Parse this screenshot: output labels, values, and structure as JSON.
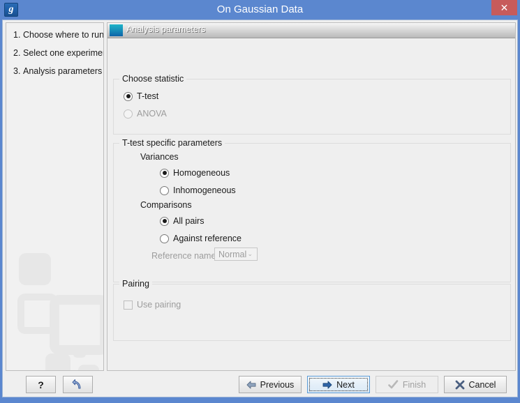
{
  "window": {
    "title": "On Gaussian Data",
    "app_icon": "g",
    "close_label": "✕",
    "accent_color": "#5b87cf",
    "close_color": "#c75b5b"
  },
  "sidebar": {
    "steps": [
      {
        "num": "1.",
        "label": "Choose where to run"
      },
      {
        "num": "2.",
        "label": "Select one experiment"
      },
      {
        "num": "3.",
        "label": "Analysis parameters"
      }
    ]
  },
  "panel": {
    "header_title": "Analysis parameters",
    "header_icon": "teal-square-icon"
  },
  "groups": {
    "choose_statistic": {
      "title": "Choose statistic",
      "options": [
        {
          "label": "T-test",
          "selected": true,
          "disabled": false
        },
        {
          "label": "ANOVA",
          "selected": false,
          "disabled": true
        }
      ]
    },
    "ttest_params": {
      "title": "T-test specific parameters",
      "variances_label": "Variances",
      "variances": [
        {
          "label": "Homogeneous",
          "selected": true,
          "disabled": false
        },
        {
          "label": "Inhomogeneous",
          "selected": false,
          "disabled": false
        }
      ],
      "comparisons_label": "Comparisons",
      "comparisons": [
        {
          "label": "All pairs",
          "selected": true,
          "disabled": false
        },
        {
          "label": "Against reference",
          "selected": false,
          "disabled": false
        }
      ],
      "reference_name_label": "Reference name",
      "reference_name_value": "Normal",
      "reference_name_arrow": "⌄",
      "reference_name_disabled": true
    },
    "pairing": {
      "title": "Pairing",
      "checkbox_label": "Use pairing",
      "checked": false,
      "disabled": true
    }
  },
  "buttons": {
    "help": "?",
    "reset_icon": "undo-arrow-icon",
    "previous": "Previous",
    "next": "Next",
    "finish": "Finish",
    "cancel": "Cancel"
  }
}
